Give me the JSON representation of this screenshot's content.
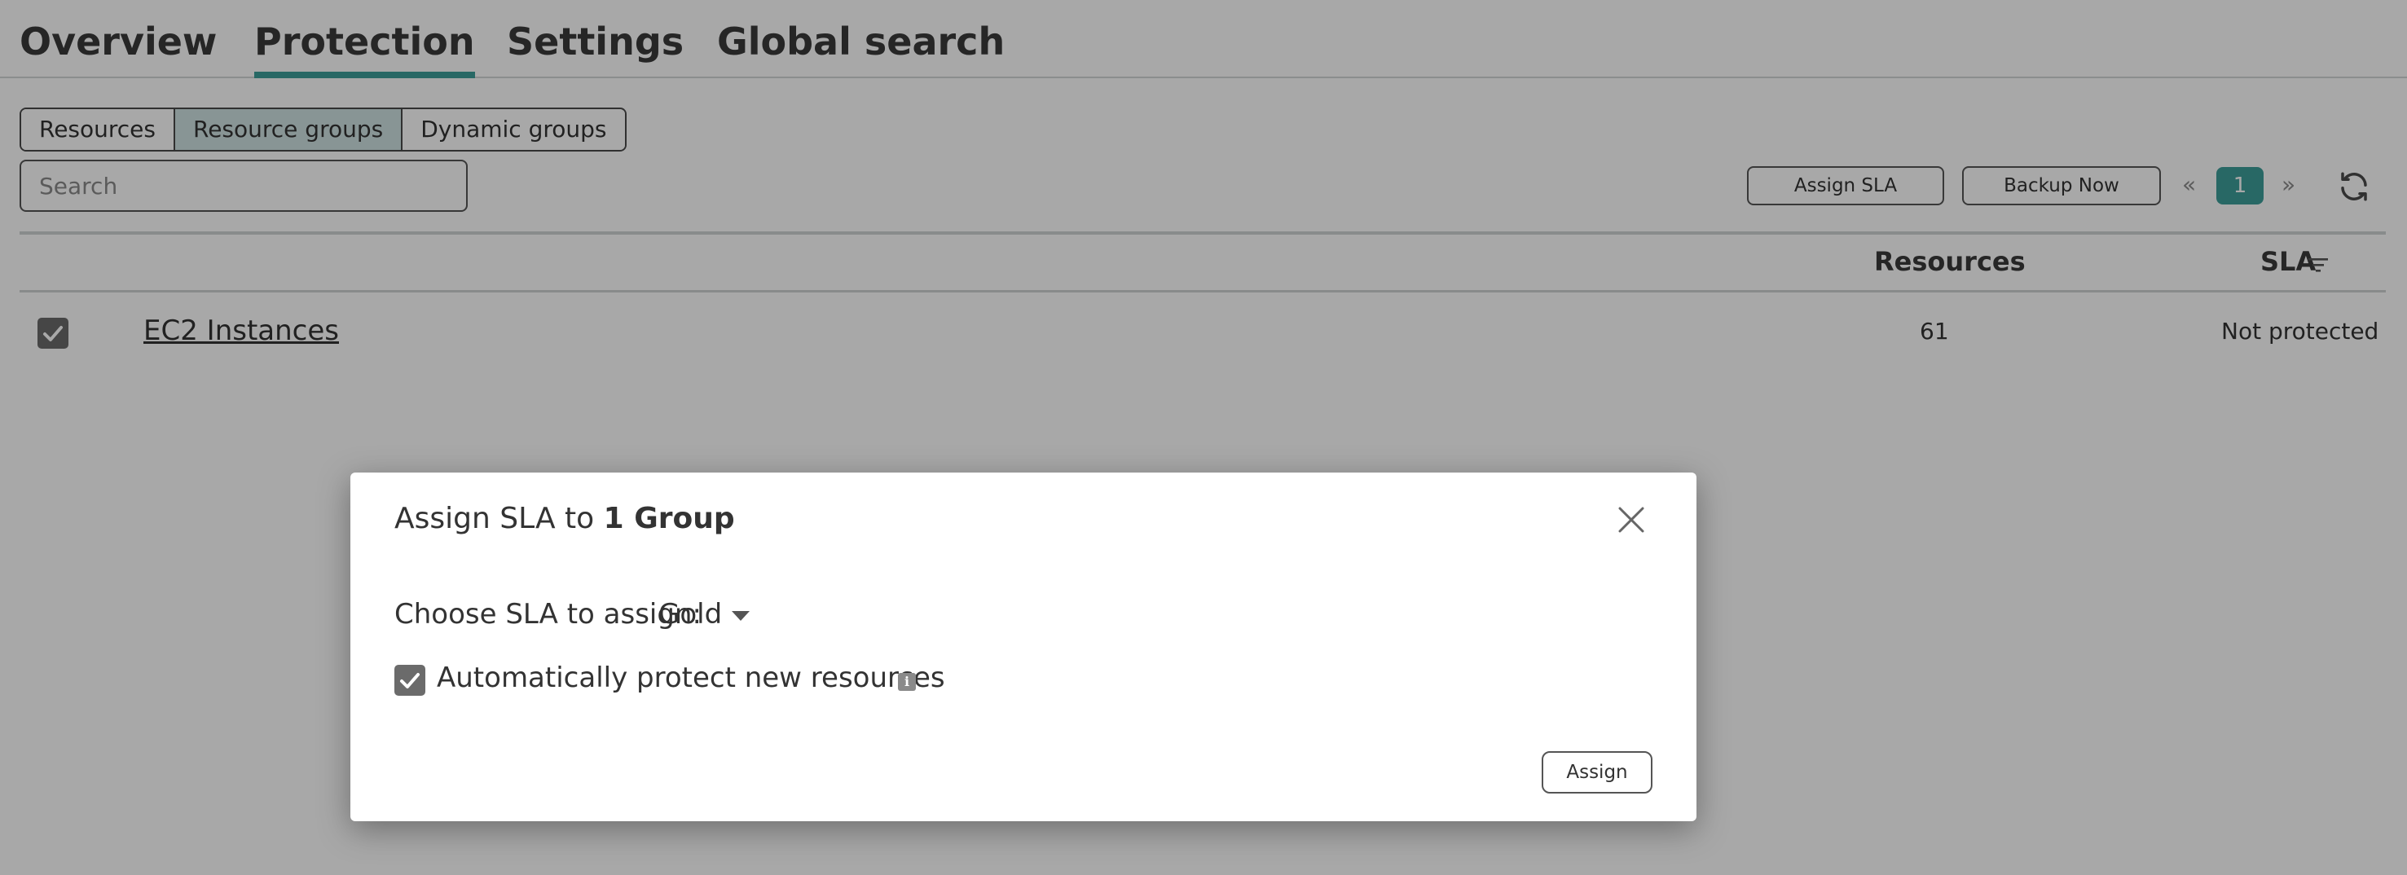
{
  "main_tabs": [
    {
      "label": "Overview"
    },
    {
      "label": "Protection"
    },
    {
      "label": "Settings"
    },
    {
      "label": "Global search"
    }
  ],
  "sub_tabs": [
    {
      "label": "Resources"
    },
    {
      "label": "Resource groups"
    },
    {
      "label": "Dynamic groups"
    }
  ],
  "search": {
    "placeholder": "Search"
  },
  "toolbar": {
    "assign_sla_label": "Assign SLA",
    "backup_now_label": "Backup Now",
    "prev_label": "«",
    "page_current": "1",
    "next_label": "»"
  },
  "table": {
    "columns": {
      "resources": "Resources",
      "sla": "SLA"
    },
    "rows": [
      {
        "name": "EC2 Instances",
        "resources": "61",
        "sla": "Not protected",
        "checked": true
      }
    ]
  },
  "modal": {
    "title_prefix": "Assign SLA to",
    "title_count": "1 Group",
    "choose_label": "Choose SLA to assign:",
    "selected_sla": "Gold",
    "auto_protect_label": "Automatically protect new resources",
    "auto_protect_checked": true,
    "info_icon_glyph": "i",
    "assign_label": "Assign"
  },
  "colors": {
    "accent": "#3e9f9a",
    "overlay": "rgba(0,0,0,0.34)",
    "checkbox": "#6b6b6b"
  },
  "icons": {
    "refresh": "refresh-icon",
    "filter": "filter-icon",
    "close": "close-icon",
    "info": "info-icon",
    "check": "checkmark-icon"
  }
}
